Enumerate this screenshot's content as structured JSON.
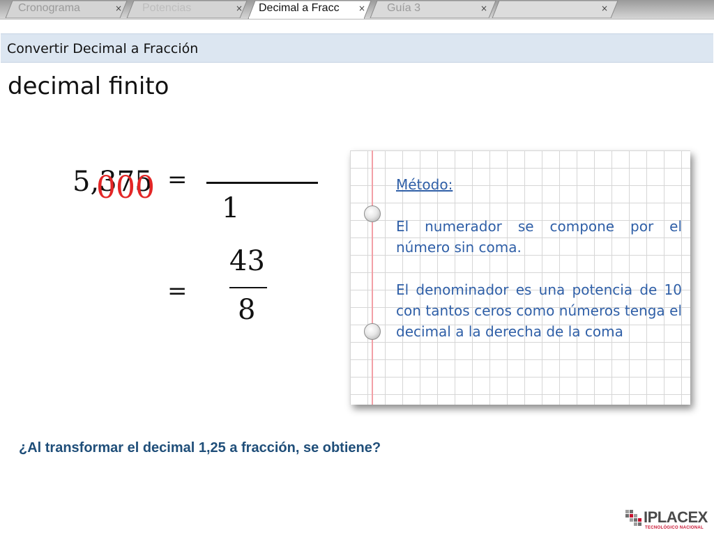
{
  "tabs": [
    {
      "label": "Cronograma",
      "active": false
    },
    {
      "label": "Potencias",
      "active": false
    },
    {
      "label": "Decimal a Fracc",
      "active": true
    },
    {
      "label": "Guía 3",
      "active": false
    },
    {
      "label": "",
      "active": false
    }
  ],
  "tab_close_glyph": "×",
  "header": {
    "title": "Convertir Decimal a Fracción"
  },
  "main": {
    "subtitle": "decimal  finito",
    "equation": {
      "decimal": "5,375",
      "equals": "=",
      "overlay_zeros": "000",
      "denominator": "1",
      "equals2": "=",
      "result_numerator": "43",
      "result_denominator": "8"
    }
  },
  "note": {
    "heading": "Método:",
    "paragraph1": "El numerador se compone por el número sin coma.",
    "paragraph2": "El denominador es una potencia de 10 con tantos ceros como números tenga el decimal a la derecha de la coma"
  },
  "question": "¿Al transformar el decimal 1,25 a fracción, se obtiene?",
  "logo": {
    "brand": "IPLACEX",
    "tagline": "TECNOLÓGICO NACIONAL"
  },
  "colors": {
    "note_text": "#2f5fa7",
    "overlay_zeros": "#e32626",
    "question": "#1f4e79",
    "header_bg": "#dce6f1",
    "logo_red": "#c8102e"
  }
}
